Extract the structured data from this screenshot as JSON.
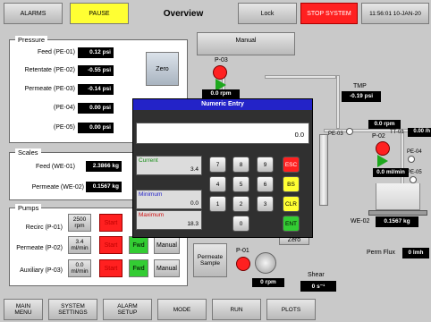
{
  "header": {
    "alarms": "ALARMS",
    "pause": "PAUSE",
    "title": "Overview",
    "lock": "Lock",
    "stop": "STOP SYSTEM",
    "datetime": "11:56:01 10-JAN-20"
  },
  "pressure": {
    "title": "Pressure",
    "rows": [
      {
        "label": "Feed (PE-01)",
        "value": "0.12 psi"
      },
      {
        "label": "Retentate (PE-02)",
        "value": "-0.55 psi"
      },
      {
        "label": "Permeate (PE-03)",
        "value": "-0.14 psi"
      },
      {
        "label": "(PE-04)",
        "value": "0.00 psi"
      },
      {
        "label": "(PE-05)",
        "value": "0.00 psi"
      }
    ],
    "zero": "Zero"
  },
  "scales": {
    "title": "Scales",
    "rows": [
      {
        "label": "Feed (WE-01)",
        "value": "2.3866 kg"
      },
      {
        "label": "Permeate (WE-02)",
        "value": "0.1567 kg"
      }
    ]
  },
  "pumps": {
    "title": "Pumps",
    "recirc": {
      "label": "Recirc (P-01)",
      "speed_num": "2500",
      "speed_unit": "rpm",
      "start": "Start"
    },
    "permeate": {
      "label": "Permeate (P-02)",
      "speed_num": "3.4",
      "speed_unit": "ml/min",
      "start": "Start",
      "fwd": "Fwd",
      "manual": "Manual"
    },
    "auxiliary": {
      "label": "Auxiliary (P-03)",
      "speed_num": "0.0",
      "speed_unit": "ml/min",
      "start": "Start",
      "fwd": "Fwd",
      "manual": "Manual"
    }
  },
  "diagram": {
    "manual": "Manual",
    "p03_label": "P-03",
    "p03_speed": "0.0 rpm",
    "tmp_label": "TMP",
    "tmp_value": "-0.19 psi",
    "pe03": "PE-03",
    "p02_speed_top": "0.0 rpm",
    "p02_label": "P-02",
    "tt01": "TT-01",
    "tt01_value": "0.00 /h",
    "pe04": "PE-04",
    "p02_flow": "0.0 ml/min",
    "pe05": "PE-05",
    "we02": "WE-02",
    "we02_value": "0.1567 kg",
    "zero2": "Zero",
    "perm_flux": "Perm Flux",
    "perm_flux_value": "0 lmh",
    "perm_sample": "Permeate Sample",
    "p01": "P-01",
    "p01_speed": "0 rpm",
    "shear": "Shear",
    "shear_value": "0 s⁻¹"
  },
  "dialog": {
    "title": "Numeric Entry",
    "entry": "0.0",
    "current_label": "Current",
    "current_value": "3.4",
    "min_label": "Minimum",
    "min_value": "0.0",
    "max_label": "Maximum",
    "max_value": "18.3",
    "keys": [
      "7",
      "8",
      "9",
      "4",
      "5",
      "6",
      "1",
      "2",
      "3",
      "0"
    ],
    "esc": "ESC",
    "bs": "BS",
    "clr": "CLR",
    "ent": "ENT"
  },
  "footer": {
    "main": [
      "MAIN",
      "MENU"
    ],
    "system": [
      "SYSTEM",
      "SETTINGS"
    ],
    "alarm": [
      "ALARM",
      "SETUP"
    ],
    "mode": "MODE",
    "run": "RUN",
    "plots": "PLOTS"
  },
  "colors": {
    "accent_yellow": "#ffff33",
    "stop_red": "#ff2020",
    "dialog_blue": "#2323c8",
    "start_red": "#ff2020",
    "fwd_green": "#33cc33"
  }
}
